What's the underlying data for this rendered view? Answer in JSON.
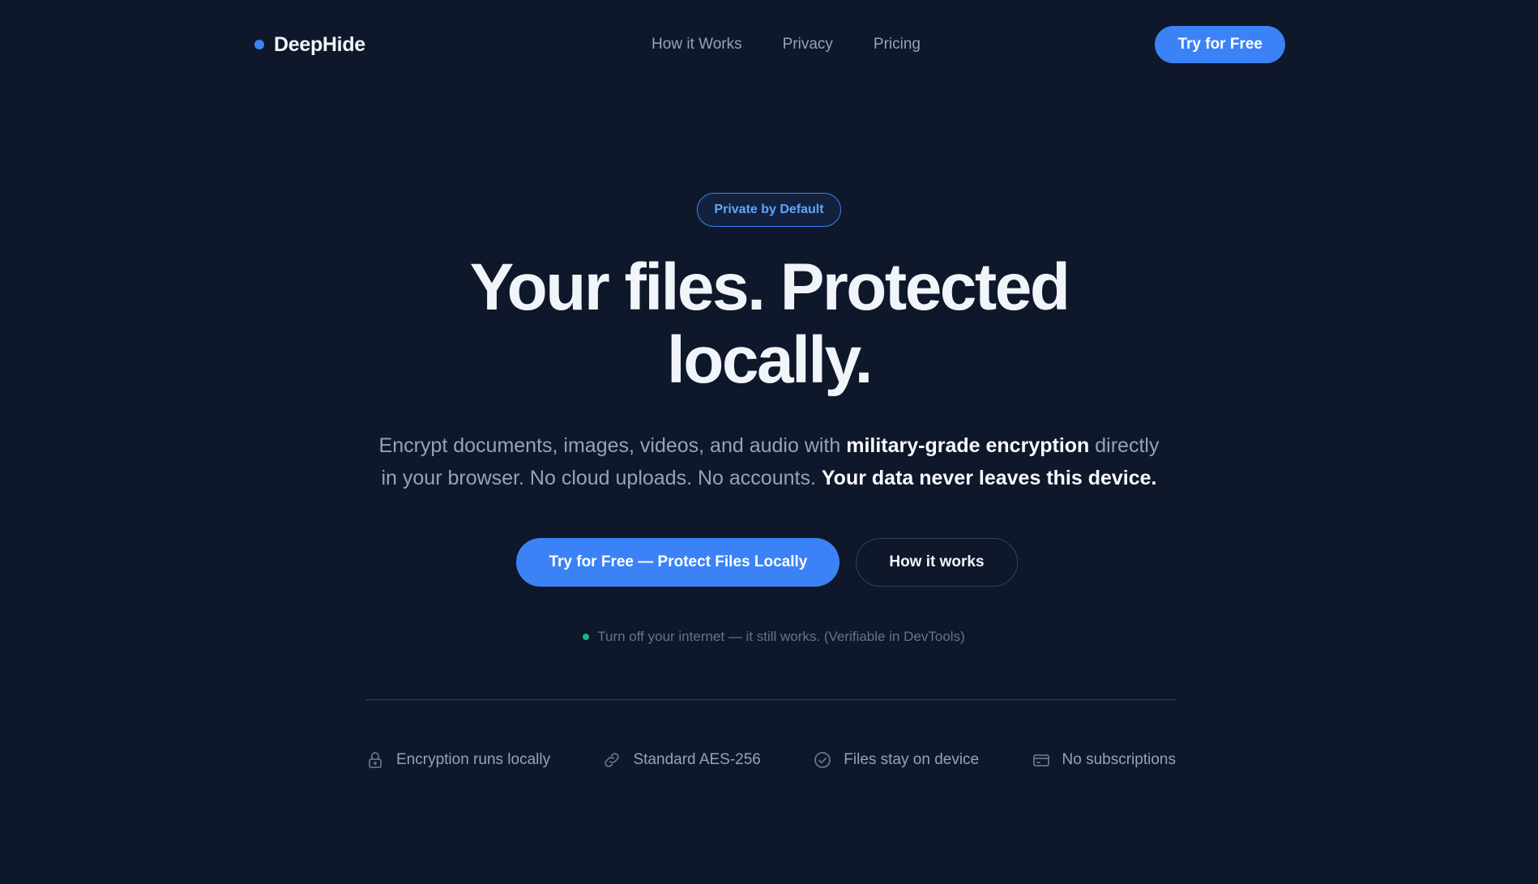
{
  "nav": {
    "brand": "DeepHide",
    "links": [
      "How it Works",
      "Privacy",
      "Pricing"
    ],
    "cta": "Try for Free"
  },
  "hero": {
    "badge": "Private by Default",
    "headline_line1": "Your files. Protected",
    "headline_line2": "locally.",
    "subtitle": {
      "part1": "Encrypt documents, images, videos, and audio with ",
      "bold1": "military-grade encryption",
      "part2": " directly in your browser. No cloud uploads. No accounts. ",
      "bold2": "Your data never leaves this device."
    },
    "primary_cta": "Try for Free — Protect Files Locally",
    "secondary_cta": "How it works",
    "offline_note": "Turn off your internet — it still works. (Verifiable in DevTools)"
  },
  "features": [
    {
      "icon": "lock-icon",
      "label": "Encryption runs locally"
    },
    {
      "icon": "link-icon",
      "label": "Standard AES-256"
    },
    {
      "icon": "check-circle-icon",
      "label": "Files stay on device"
    },
    {
      "icon": "credit-card-icon",
      "label": "No subscriptions"
    }
  ],
  "colors": {
    "background": "#0f172a",
    "accent": "#3b82f6",
    "status_green": "#10b981"
  }
}
